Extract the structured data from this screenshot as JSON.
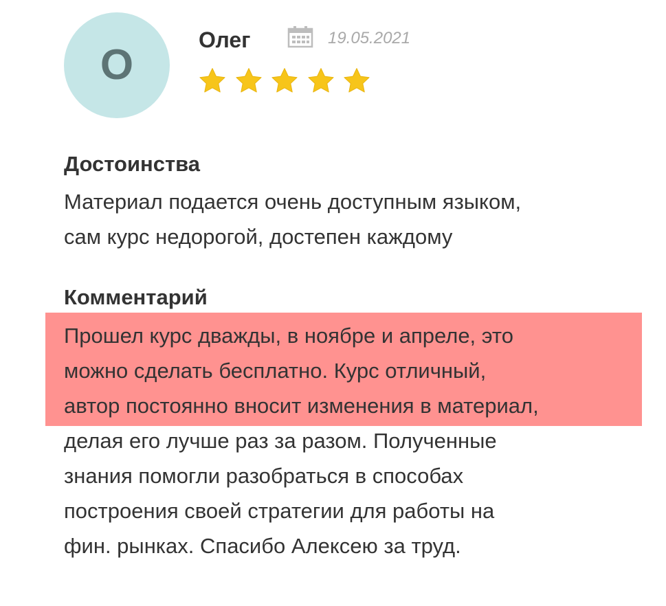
{
  "review": {
    "avatar_letter": "О",
    "author": "Олег",
    "date": "19.05.2021",
    "rating": 5,
    "rating_max": 5,
    "pros_title": "Достоинства",
    "pros_lines": [
      "Материал подается очень доступным языком,",
      "сам курс недорогой, достепен каждому"
    ],
    "comment_title": "Комментарий",
    "comment_lines": [
      "Прошел курс дважды, в ноябре и апреле, это",
      "можно сделать бесплатно. Курс отличный,",
      "автор постоянно вносит изменения в материал,",
      "делая его лучше раз за разом. Полученные",
      "знания помогли разобраться в способах",
      "построения своей стратегии для работы на",
      "фин. рынках. Спасибо Алексею за труд."
    ],
    "highlighted_comment_lines": 3
  },
  "icons": {
    "calendar": "calendar-icon",
    "star": "star-icon"
  },
  "colors": {
    "avatar_bg": "#c5e6e7",
    "avatar_letter": "#5d7475",
    "star": "#f7c51a",
    "highlight": "#ff9290",
    "text": "#333333",
    "date": "#a9a9a9"
  }
}
